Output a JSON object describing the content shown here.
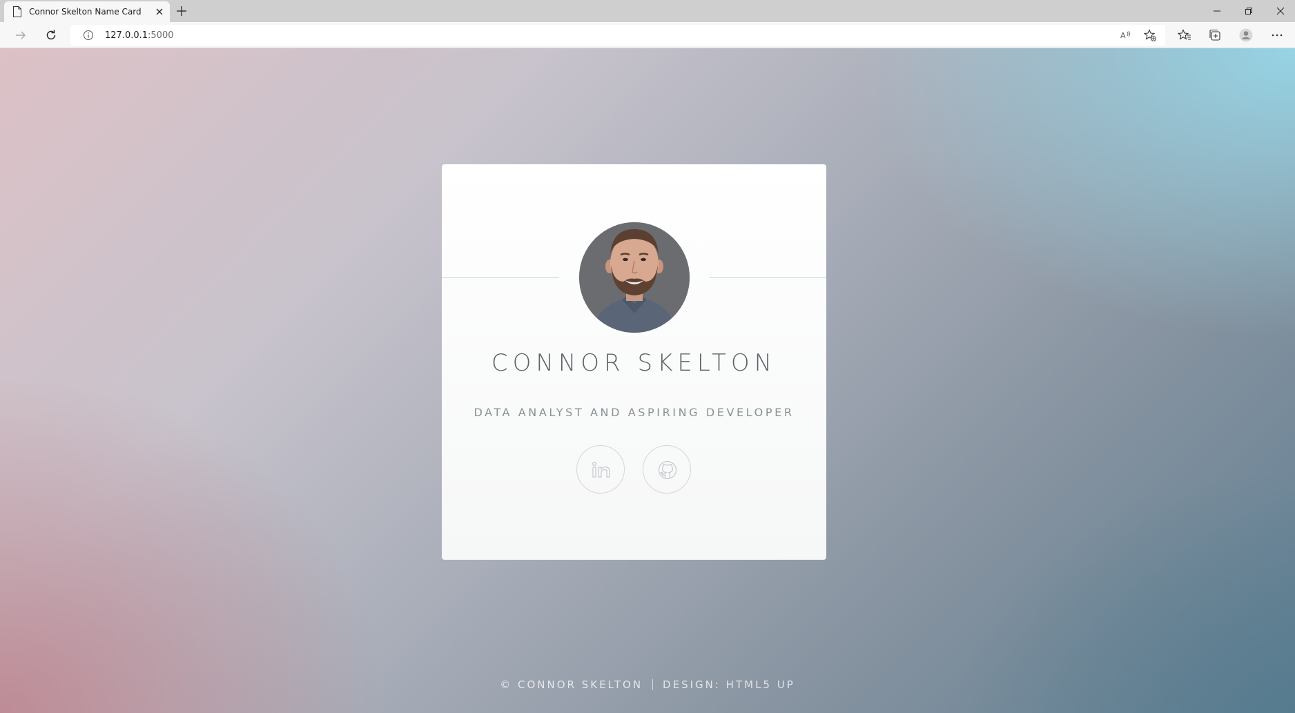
{
  "browser": {
    "tab": {
      "title": "Connor Skelton Name Card"
    },
    "address": {
      "host": "127.0.0.1",
      "port": ":5000"
    }
  },
  "card": {
    "name": "CONNOR SKELTON",
    "tagline": "DATA ANALYST AND ASPIRING DEVELOPER",
    "social": [
      {
        "icon": "linkedin-icon"
      },
      {
        "icon": "github-icon"
      }
    ]
  },
  "footer": {
    "copyright": "© CONNOR SKELTON",
    "design": "DESIGN: HTML5 UP"
  }
}
